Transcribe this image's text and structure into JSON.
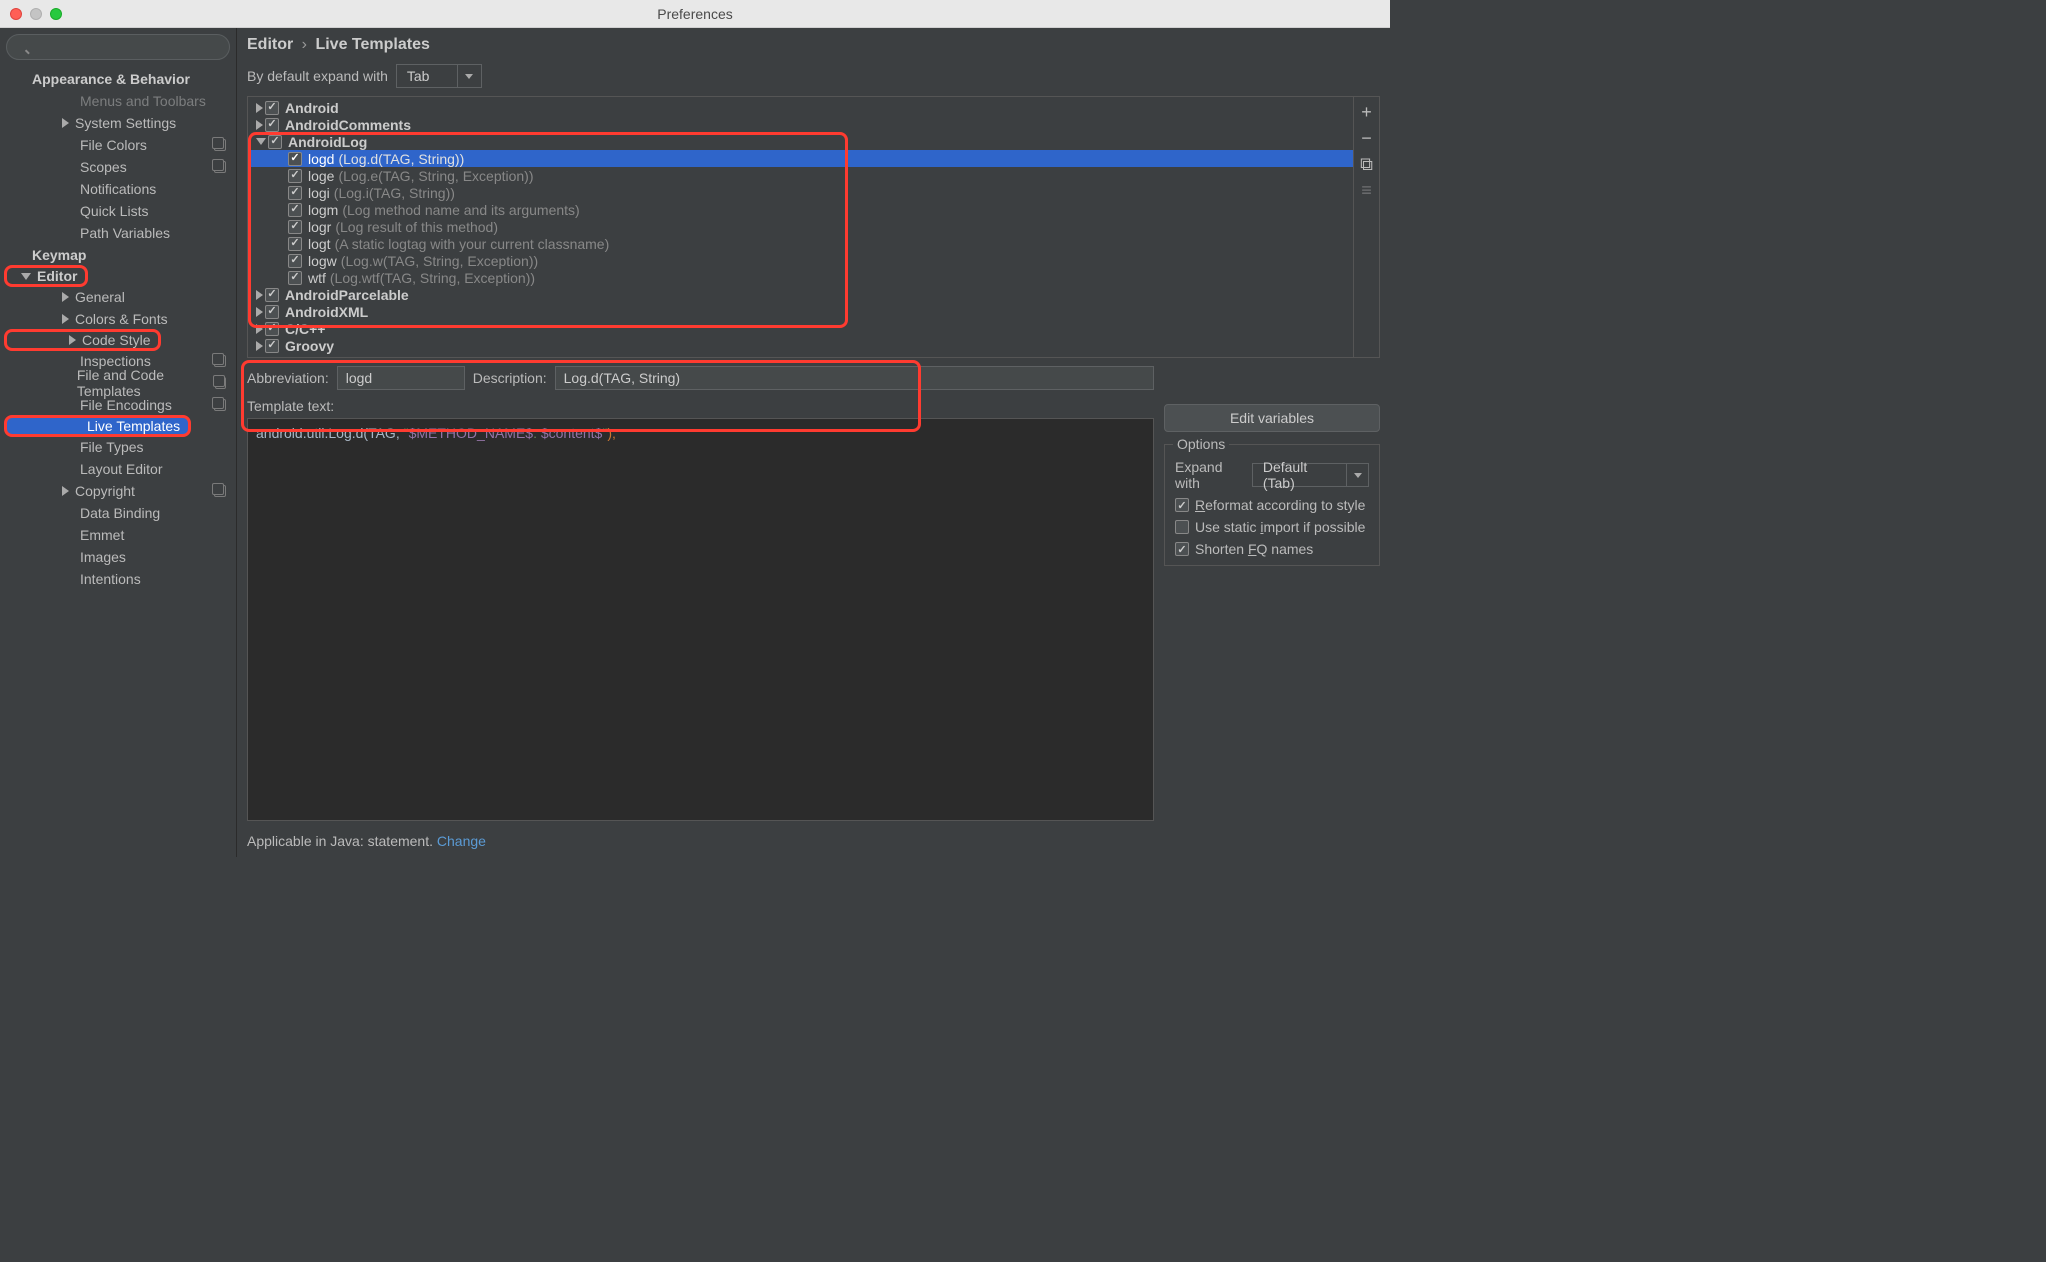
{
  "window": {
    "title": "Preferences"
  },
  "breadcrumb": {
    "parent": "Editor",
    "sep": "›",
    "current": "Live Templates"
  },
  "expand": {
    "label": "By default expand with",
    "value": "Tab"
  },
  "sidebar": {
    "groups": [
      {
        "label": "Appearance & Behavior",
        "top": true
      },
      {
        "label": "Menus and Toolbars",
        "faded": true
      },
      {
        "label": "System Settings",
        "arrow": "right"
      },
      {
        "label": "File Colors",
        "copy": true
      },
      {
        "label": "Scopes",
        "copy": true
      },
      {
        "label": "Notifications"
      },
      {
        "label": "Quick Lists"
      },
      {
        "label": "Path Variables"
      },
      {
        "label": "Keymap",
        "top": true
      },
      {
        "label": "Editor",
        "top": true,
        "arrow": "down",
        "hl": true
      },
      {
        "label": "General",
        "arrow": "right"
      },
      {
        "label": "Colors & Fonts",
        "arrow": "right"
      },
      {
        "label": "Code Style",
        "arrow": "right",
        "copy": true,
        "hl": true
      },
      {
        "label": "Inspections",
        "copy": true
      },
      {
        "label": "File and Code Templates",
        "copy": true
      },
      {
        "label": "File Encodings",
        "copy": true
      },
      {
        "label": "Live Templates",
        "selected": true,
        "hl": true,
        "copy": true
      },
      {
        "label": "File Types"
      },
      {
        "label": "Layout Editor"
      },
      {
        "label": "Copyright",
        "arrow": "right",
        "copy": true
      },
      {
        "label": "Data Binding"
      },
      {
        "label": "Emmet"
      },
      {
        "label": "Images"
      },
      {
        "label": "Intentions"
      }
    ]
  },
  "tree": {
    "groups": [
      {
        "label": "Android",
        "arrow": "right",
        "checked": true
      },
      {
        "label": "AndroidComments",
        "arrow": "right",
        "checked": true
      },
      {
        "label": "AndroidLog",
        "arrow": "down",
        "checked": true,
        "items": [
          {
            "abbr": "logd",
            "desc": "(Log.d(TAG, String))",
            "checked": true,
            "selected": true
          },
          {
            "abbr": "loge",
            "desc": "(Log.e(TAG, String, Exception))",
            "checked": true
          },
          {
            "abbr": "logi",
            "desc": "(Log.i(TAG, String))",
            "checked": true
          },
          {
            "abbr": "logm",
            "desc": "(Log method name and its arguments)",
            "checked": true
          },
          {
            "abbr": "logr",
            "desc": "(Log result of this method)",
            "checked": true
          },
          {
            "abbr": "logt",
            "desc": "(A static logtag with your current classname)",
            "checked": true
          },
          {
            "abbr": "logw",
            "desc": "(Log.w(TAG, String, Exception))",
            "checked": true
          },
          {
            "abbr": "wtf",
            "desc": "(Log.wtf(TAG, String, Exception))",
            "checked": true
          }
        ]
      },
      {
        "label": "AndroidParcelable",
        "arrow": "right",
        "checked": true
      },
      {
        "label": "AndroidXML",
        "arrow": "right",
        "checked": true
      },
      {
        "label": "C/C++",
        "arrow": "right",
        "checked": true
      },
      {
        "label": "Groovy",
        "arrow": "right",
        "checked": true
      }
    ],
    "side": [
      "+",
      "−",
      "⧉",
      "≡"
    ]
  },
  "detail": {
    "abbrLabel": "Abbreviation:",
    "abbr": "logd",
    "descLabel": "Description:",
    "desc": "Log.d(TAG, String)",
    "templateLabel": "Template text:",
    "templateParts": {
      "p1": "android.util.Log.d(TAG, ",
      "str1": "\"",
      "var1": "$METHOD_NAME$",
      "str2": ": ",
      "var2": "$content$",
      "str3": "\"",
      "p2": ");"
    },
    "editVarBtn": "Edit variables",
    "optionsLegend": "Options",
    "expandLabel": "Expand with",
    "expandValue": "Default (Tab)",
    "opts": [
      {
        "label_pre": "R",
        "label": "eformat according to style",
        "checked": true
      },
      {
        "label_pre": "Use static ",
        "label_u": "i",
        "label_post": "mport if possible",
        "checked": false
      },
      {
        "label_pre": "Shorten ",
        "label_u": "F",
        "label_post": "Q names",
        "checked": true
      }
    ],
    "applicable": "Applicable in Java: statement. ",
    "change": "Change"
  }
}
